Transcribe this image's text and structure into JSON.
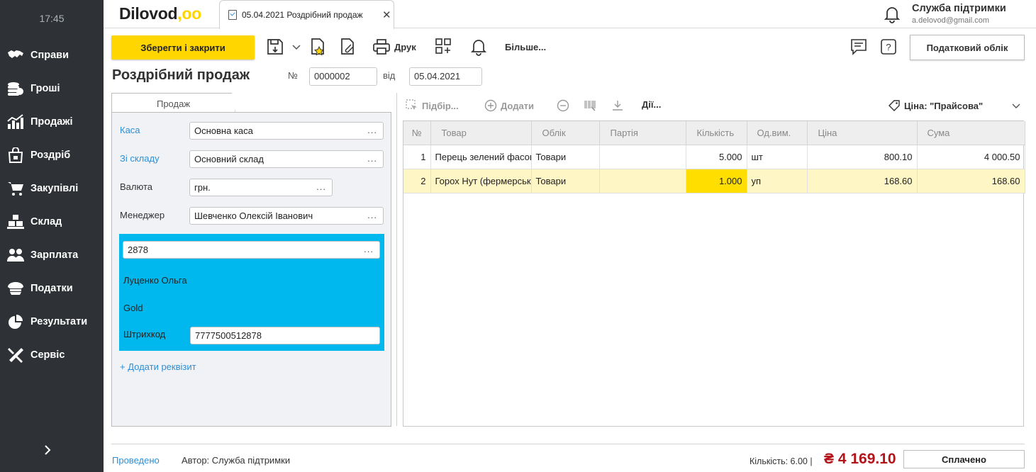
{
  "sidebar": {
    "time": "17:45",
    "items": [
      {
        "label": "Справи",
        "icon": "handshake-icon"
      },
      {
        "label": "Гроші",
        "icon": "coins-icon"
      },
      {
        "label": "Продажі",
        "icon": "chart-bars-icon"
      },
      {
        "label": "Роздріб",
        "icon": "shopping-bag-icon"
      },
      {
        "label": "Закупівлі",
        "icon": "cart-icon"
      },
      {
        "label": "Склад",
        "icon": "boxes-icon"
      },
      {
        "label": "Зарплата",
        "icon": "people-icon"
      },
      {
        "label": "Податки",
        "icon": "officer-cap-icon"
      },
      {
        "label": "Результати",
        "icon": "pie-chart-icon"
      },
      {
        "label": "Сервіс",
        "icon": "tools-icon"
      }
    ]
  },
  "header": {
    "logo_text": "Dilovod",
    "logo_dots": ",oo",
    "tab_title": "05.04.2021 Роздрібний продаж",
    "user_name": "Служба підтримки",
    "user_email": "a.delovod@gmail.com"
  },
  "toolbar": {
    "save_close": "Зберегти і закрити",
    "print": "Друк",
    "more": "Більше...",
    "tax_accounting": "Податковий облік"
  },
  "document": {
    "title": "Роздрібний продаж",
    "number_label": "№",
    "number": "0000002",
    "date_label": "від",
    "date": "05.04.2021"
  },
  "form": {
    "tab_label": "Продаж",
    "cash_label": "Каса",
    "cash_value": "Основна каса",
    "warehouse_label": "Зі складу",
    "warehouse_value": "Основний склад",
    "currency_label": "Валюта",
    "currency_value": "грн.",
    "manager_label": "Менеджер",
    "manager_value": "Шевченко Олексій Іванович",
    "card_value": "2878",
    "client_name": "Луценко Ольга",
    "card_level": "Gold",
    "barcode_label": "Штрихкод",
    "barcode_value": "7777500512878",
    "add_attribute": "+ Додати реквізит",
    "ellipsis": "..."
  },
  "grid_toolbar": {
    "pick": "Підбір...",
    "add": "Додати",
    "actions": "Дії...",
    "price": "Ціна: \"Прайсова\""
  },
  "table": {
    "columns": [
      "№",
      "Товар",
      "Облік",
      "Партія",
      "Кількість",
      "Од.вим.",
      "Ціна",
      "Сума"
    ],
    "rows": [
      {
        "n": "1",
        "product": "Перець зелений фасований",
        "account": "Товари",
        "batch": "",
        "qty": "5.000",
        "unit": "шт",
        "price": "800.10",
        "sum": "4 000.50"
      },
      {
        "n": "2",
        "product": "Горох Нут (фермерський)",
        "account": "Товари",
        "batch": "",
        "qty": "1.000",
        "unit": "уп",
        "price": "168.60",
        "sum": "168.60"
      }
    ]
  },
  "footer": {
    "status": "Проведено",
    "author": "Автор: Служба підтримки",
    "quantity": "Кількість: 6.00 |",
    "total": "₴ 4 169.10",
    "paid": "Сплачено"
  }
}
